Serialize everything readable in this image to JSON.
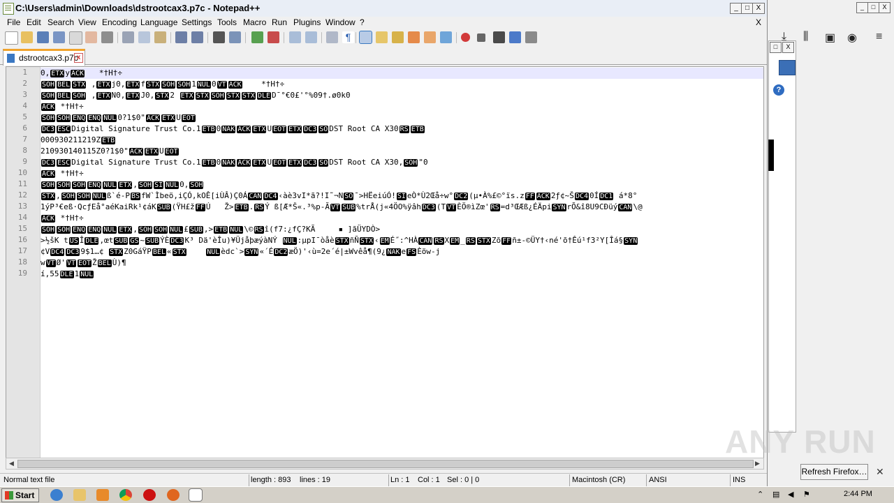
{
  "window": {
    "title": "C:\\Users\\admin\\Downloads\\dstrootcax3.p7c - Notepad++",
    "minimize": "_",
    "maximize": "□",
    "close": "X"
  },
  "menu": {
    "items": [
      "File",
      "Edit",
      "Search",
      "View",
      "Encoding",
      "Language",
      "Settings",
      "Tools",
      "Macro",
      "Run",
      "Plugins",
      "Window",
      "?"
    ],
    "close_doc": "X"
  },
  "tab": {
    "label": "dstrootcax3.p7c",
    "close": "x"
  },
  "editor": {
    "line_numbers": [
      "1",
      "2",
      "3",
      "4",
      "5",
      "6",
      "7",
      "8",
      "9",
      "10",
      "11",
      "12",
      "13",
      "14",
      "15",
      "16",
      "17",
      "18",
      "19"
    ]
  },
  "status": {
    "type": "Normal text file",
    "length": "length : 893",
    "lines": "lines : 19",
    "ln": "Ln : 1",
    "col": "Col : 1",
    "sel": "Sel : 0 | 0",
    "eol": "Macintosh (CR)",
    "encoding": "ANSI",
    "mode": "INS"
  },
  "firefox": {
    "refresh_label": "Refresh Firefox…",
    "close": "✕",
    "help": "?"
  },
  "watermark": "ANY RUN",
  "taskbar": {
    "start": "Start",
    "clock": "2:44 PM"
  },
  "colors": {
    "control_char_bg": "#000000",
    "control_char_fg": "#ffffff",
    "current_line": "#e8e8ff",
    "tab_accent": "#f1a32b"
  }
}
